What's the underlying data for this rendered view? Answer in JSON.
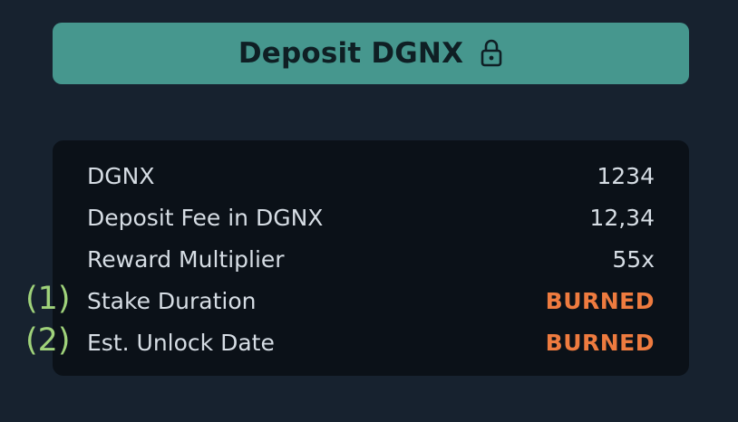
{
  "deposit_button": {
    "label": "Deposit DGNX",
    "icon": "lock-icon"
  },
  "colors": {
    "background": "#17222f",
    "button": "#46978e",
    "panel": "#0b1118",
    "burned": "#ee7b3f",
    "marker": "#9fd27a"
  },
  "summary": {
    "rows": [
      {
        "label": "DGNX",
        "value": "1234"
      },
      {
        "label": "Deposit Fee in DGNX",
        "value": "12,34"
      },
      {
        "label": "Reward Multiplier",
        "value": "55x"
      },
      {
        "label": "Stake Duration",
        "value": "BURNED"
      },
      {
        "label": "Est. Unlock Date",
        "value": "BURNED"
      }
    ]
  },
  "annotations": {
    "marker_1": "(1)",
    "marker_2": "(2)"
  }
}
